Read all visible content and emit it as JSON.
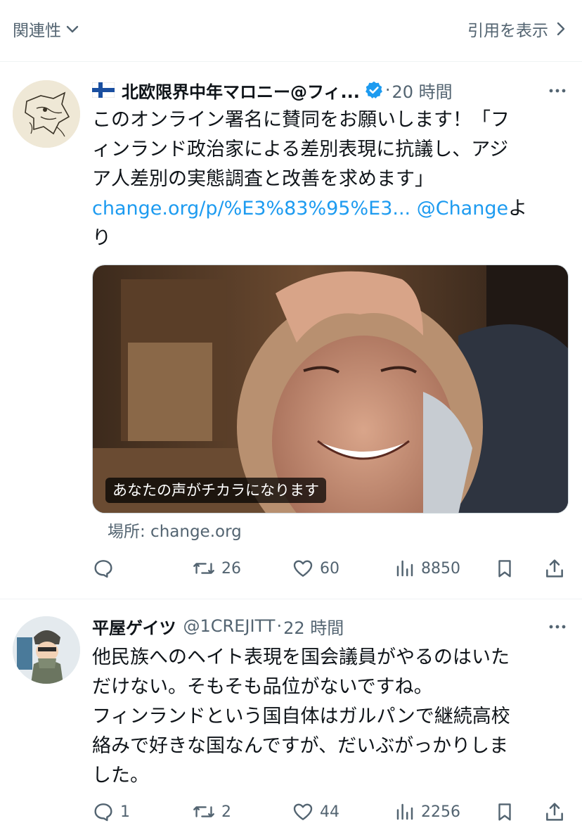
{
  "topbar": {
    "sort_label": "関連性",
    "quotes_label": "引用を表示"
  },
  "tweets": [
    {
      "display_name": "北欧限界中年マロニー@フィ...",
      "verified": true,
      "time": "20 時間",
      "text_lines": [
        "このオンライン署名に賛同をお願いします！「フ",
        "ィンランド政治家による差別表現に抗議し、アジ",
        "ア人差別の実態調査と改善を求めます」"
      ],
      "link_text": "change.org/p/%E3%83%95%E3...",
      "mention": "@Change",
      "text_suffix_1": "よ",
      "text_suffix_2": "り",
      "card": {
        "caption": "あなたの声がチカラになります",
        "source": "場所: change.org"
      },
      "stats": {
        "replies": "",
        "retweets": "26",
        "likes": "60",
        "views": "8850"
      }
    },
    {
      "display_name": "平屋ゲイツ",
      "handle": "@1CREJITT",
      "time": "22 時間",
      "text_lines": [
        "他民族へのヘイト表現を国会議員がやるのはいた",
        "だけない。そもそも品位がないですね。",
        "フィンランドという国自体はガルパンで継続高校",
        "絡みで好きな国なんですが、だいぶがっかりしま",
        "した。"
      ],
      "stats": {
        "replies": "1",
        "retweets": "2",
        "likes": "44",
        "views": "2256"
      }
    }
  ],
  "colors": {
    "link": "#1d9bf0",
    "secondary_text": "#536471",
    "border": "#eff3f4"
  }
}
